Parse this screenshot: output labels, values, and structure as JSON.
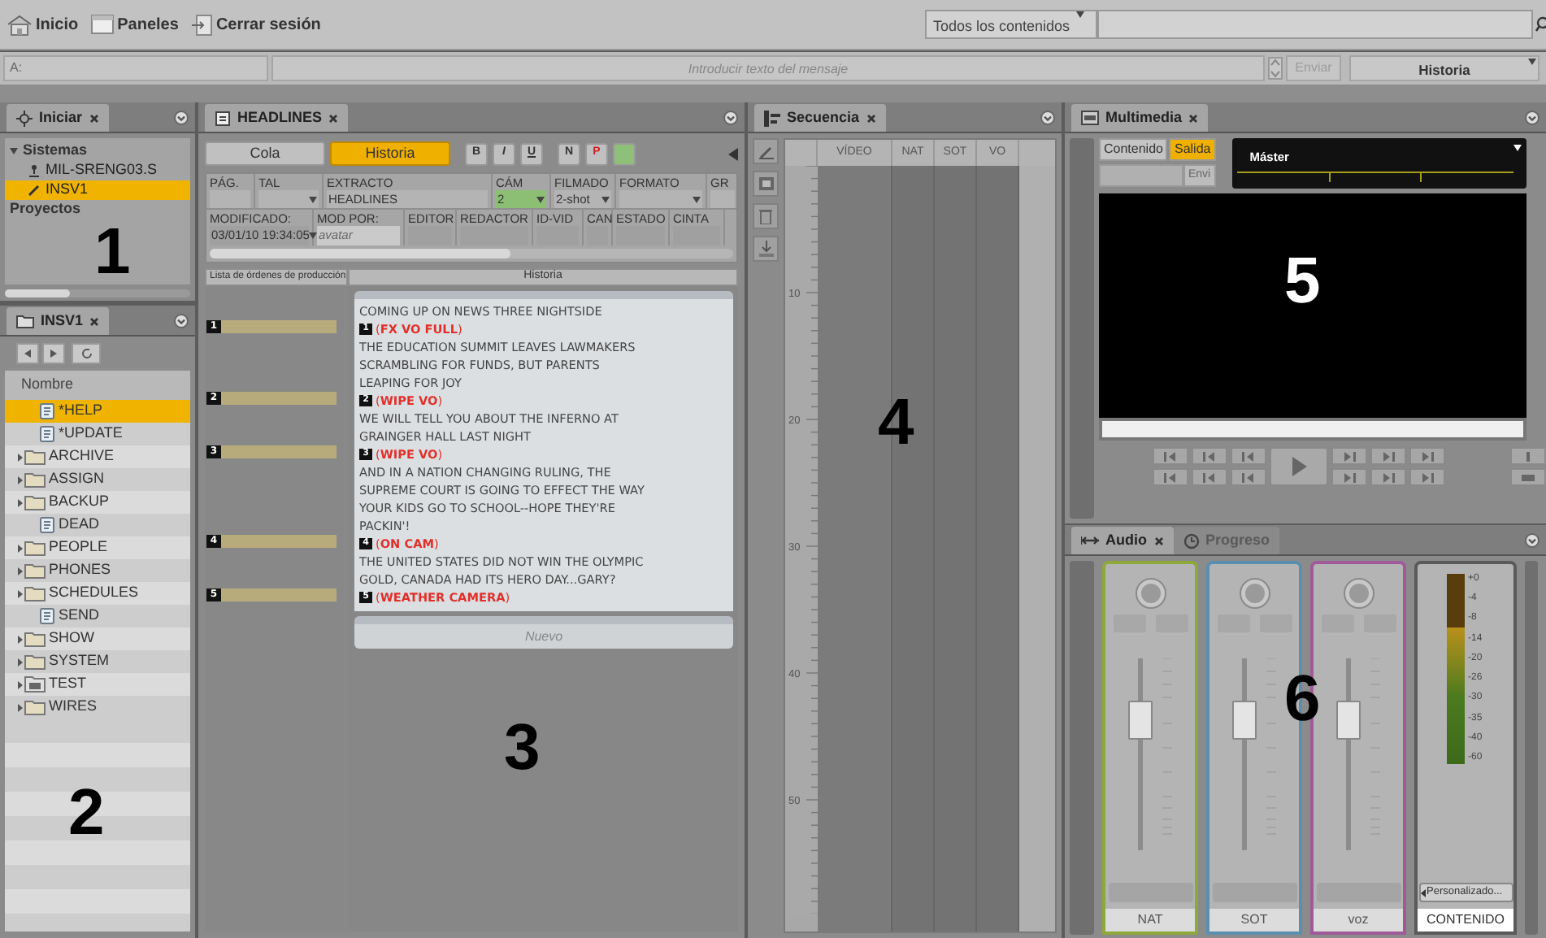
{
  "top_bar": {
    "links": [
      {
        "label": "Inicio",
        "kind": "home"
      },
      {
        "label": "Paneles",
        "kind": "panels"
      },
      {
        "label": "Cerrar sesión",
        "kind": "logout"
      }
    ],
    "search_scope": "Todos los contenidos"
  },
  "message_bar": {
    "to_label": "A:",
    "placeholder": "Introducir texto del mensaje",
    "send": "Enviar",
    "send_disabled": true,
    "view": "Historia"
  },
  "launch_panel": {
    "tab": "Iniciar",
    "tree": [
      {
        "label": "Sistemas",
        "expanded": true,
        "selected": false,
        "children": [
          {
            "label": "MIL-SRENG03.S",
            "kind": "server",
            "selected": false
          },
          {
            "label": "INSV1",
            "kind": "database",
            "selected": true
          }
        ]
      },
      {
        "label": "Proyectos",
        "selected": false
      }
    ]
  },
  "folder_panel": {
    "tab": "INSV1",
    "column": "Nombre",
    "items": [
      {
        "label": "*HELP",
        "kind": "story",
        "selected": true
      },
      {
        "label": "*UPDATE",
        "kind": "story",
        "selected": false
      },
      {
        "label": "ARCHIVE",
        "kind": "folder",
        "selected": false
      },
      {
        "label": "ASSIGN",
        "kind": "folder",
        "selected": false
      },
      {
        "label": "BACKUP",
        "kind": "folder",
        "selected": false
      },
      {
        "label": "DEAD",
        "kind": "story",
        "selected": false
      },
      {
        "label": "PEOPLE",
        "kind": "folder",
        "selected": false
      },
      {
        "label": "PHONES",
        "kind": "folder",
        "selected": false
      },
      {
        "label": "SCHEDULES",
        "kind": "folder",
        "selected": false
      },
      {
        "label": "SEND",
        "kind": "story",
        "selected": false
      },
      {
        "label": "SHOW",
        "kind": "folder",
        "selected": false
      },
      {
        "label": "SYSTEM",
        "kind": "folder",
        "selected": false
      },
      {
        "label": "TEST",
        "kind": "queue",
        "selected": false
      },
      {
        "label": "WIRES",
        "kind": "folder",
        "selected": false
      }
    ]
  },
  "story_panel": {
    "tab": "HEADLINES",
    "modes": [
      {
        "label": "Cola",
        "selected": false
      },
      {
        "label": "Historia",
        "selected": true
      }
    ],
    "format_buttons": [
      {
        "label": "B",
        "kind": "plain"
      },
      {
        "label": "I",
        "kind": "italic"
      },
      {
        "label": "U",
        "kind": "underline"
      },
      {
        "label": "N",
        "kind": "plain"
      },
      {
        "label": "P",
        "kind": "red"
      },
      {
        "kind": "green"
      }
    ],
    "fields_row_1": [
      {
        "label": "PÁG.",
        "dropdown": false,
        "highlighted": false
      },
      {
        "label": "TAL",
        "dropdown": true,
        "highlighted": false
      },
      {
        "label": "EXTRACTO",
        "value": "HEADLINES",
        "dropdown": false,
        "highlighted": false
      },
      {
        "label": "CÁM",
        "value": "2",
        "dropdown": true,
        "highlighted": true
      },
      {
        "label": "FILMADO",
        "value": "2-shot",
        "dropdown": true,
        "highlighted": false
      },
      {
        "label": "FORMATO",
        "dropdown": true,
        "highlighted": false
      },
      {
        "label": "GR",
        "dropdown": false,
        "highlighted": false
      }
    ],
    "fields_row_2": [
      {
        "label": "MODIFICADO:",
        "value": "03/01/10 19:34:05",
        "dropdown": true,
        "disabled": false
      },
      {
        "label": "MOD POR:",
        "value": "avatar",
        "dropdown": false,
        "disabled": true
      },
      {
        "label": "EDITOR",
        "dropdown": false,
        "disabled": false
      },
      {
        "label": "REDACTOR",
        "dropdown": false,
        "disabled": false
      },
      {
        "label": "ID-VID",
        "dropdown": false,
        "disabled": false
      },
      {
        "label": "CAN",
        "dropdown": false,
        "disabled": false
      },
      {
        "label": "ESTADO",
        "dropdown": false,
        "disabled": false
      },
      {
        "label": "CINTA",
        "dropdown": false,
        "disabled": false
      }
    ],
    "orders_header": "Lista de órdenes de producción",
    "story_header": "Historia",
    "lines": [
      {
        "kind": "text",
        "text": "COMING UP ON NEWS THREE NIGHTSIDE"
      },
      {
        "kind": "cue",
        "marker": "1",
        "number": "1",
        "text": "(**FX VO FULL**)"
      },
      {
        "kind": "text",
        "text": "THE EDUCATION SUMMIT LEAVES LAWMAKERS"
      },
      {
        "kind": "text",
        "text": "SCRAMBLING FOR FUNDS, BUT PARENTS"
      },
      {
        "kind": "text",
        "text": "LEAPING FOR JOY"
      },
      {
        "kind": "cue",
        "marker": "2",
        "number": "2",
        "text": "(**WIPE VO**)"
      },
      {
        "kind": "text",
        "text": "WE WILL TELL YOU ABOUT THE INFERNO AT"
      },
      {
        "kind": "text",
        "text": "GRAINGER HALL LAST NIGHT"
      },
      {
        "kind": "cue",
        "marker": "3",
        "number": "3",
        "text": "(**WIPE VO**)"
      },
      {
        "kind": "text",
        "text": "AND IN A NATION CHANGING RULING, THE"
      },
      {
        "kind": "text",
        "text": "SUPREME COURT IS GOING TO EFFECT THE WAY"
      },
      {
        "kind": "text",
        "text": "YOUR KIDS GO TO SCHOOL--HOPE THEY'RE"
      },
      {
        "kind": "text",
        "text": "PACKIN'!"
      },
      {
        "kind": "cue",
        "marker": "4",
        "number": "4",
        "text": "(**ON CAM**)"
      },
      {
        "kind": "text",
        "text": "THE UNITED STATES DID NOT WIN THE OLYMPIC"
      },
      {
        "kind": "text",
        "text": "GOLD, CANADA HAD ITS HERO DAY...GARY?"
      },
      {
        "kind": "cue",
        "marker": "5",
        "number": "5",
        "text": "(**WEATHER CAMERA**)"
      }
    ],
    "new_button": "Nuevo"
  },
  "sequence_panel": {
    "tab": "Secuencia",
    "columns": [
      "VÍDEO",
      "NAT",
      "SOT",
      "VO"
    ],
    "ruler_labels": [
      "10",
      "20",
      "30",
      "40",
      "50"
    ]
  },
  "media_panel": {
    "tab": "Multimedia",
    "modes": [
      {
        "label": "Contenido",
        "selected": false
      },
      {
        "label": "Salida",
        "selected": true
      }
    ],
    "send": "Envi",
    "channel": "Máster"
  },
  "audio_panel": {
    "tabs": [
      {
        "label": "Audio",
        "selected": true
      },
      {
        "label": "Progreso",
        "selected": false
      }
    ],
    "strips": [
      {
        "name": "NAT",
        "color": "#8fa83c",
        "level": 0.72
      },
      {
        "name": "SOT",
        "color": "#5a8fb0",
        "level": 0.72
      },
      {
        "name": "voz",
        "color": "#a05a9a",
        "level": 0.72
      }
    ],
    "master": {
      "scale": [
        "+0",
        "-4",
        "-8",
        "-14",
        "-20",
        "-26",
        "-30",
        "-35",
        "-40",
        "-60"
      ],
      "level": 0.72,
      "preset": "Personalizado...",
      "name": "CONTENIDO"
    }
  },
  "callouts": [
    "1",
    "2",
    "3",
    "4",
    "5",
    "6"
  ]
}
